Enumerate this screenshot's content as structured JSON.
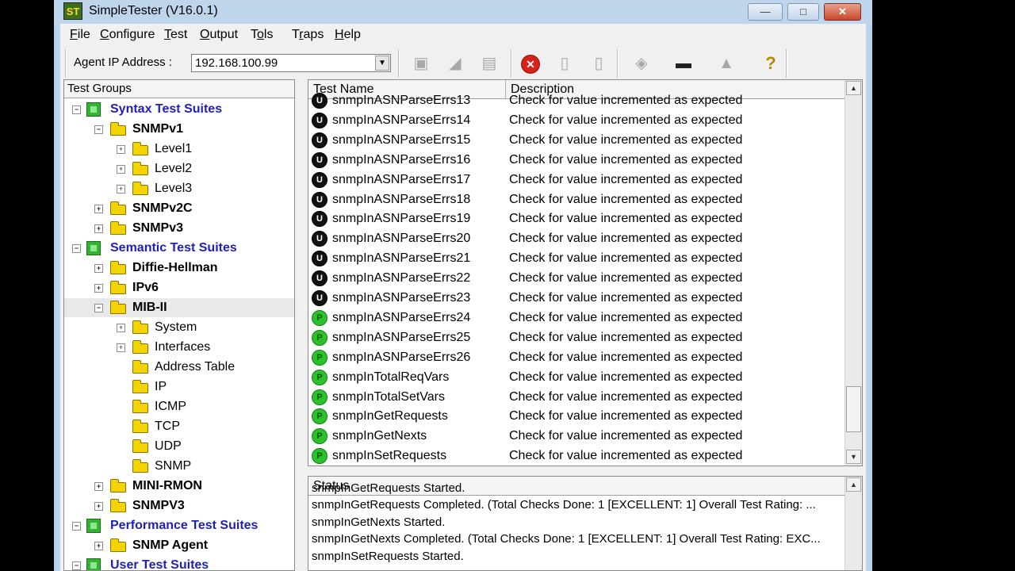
{
  "window": {
    "app_icon": "ST",
    "title": "SimpleTester (V16.0.1)",
    "controls": {
      "minimize": "—",
      "maximize": "□",
      "close": "✕"
    }
  },
  "menu": [
    {
      "label": "File",
      "accel": "F",
      "rest": "ile"
    },
    {
      "label": "Configure",
      "accel": "C",
      "rest": "onfigure"
    },
    {
      "label": "Test",
      "accel": "T",
      "rest": "est"
    },
    {
      "label": "Output",
      "accel": "O",
      "rest": "utput"
    },
    {
      "label": "Tools",
      "accel": "o",
      "pre": "T",
      "rest": "ls"
    },
    {
      "label": "Traps",
      "accel": "r",
      "pre": "T",
      "rest": "aps"
    },
    {
      "label": "Help",
      "accel": "H",
      "rest": "elp"
    }
  ],
  "toolbar": {
    "agent_ip_label": "Agent IP Address :",
    "agent_ip_value": "192.168.100.99",
    "icons": [
      "new-icon",
      "open-icon",
      "save-icon",
      "stop-icon",
      "report-icon",
      "export-icon",
      "notes-icon",
      "trap-icon",
      "alert-icon",
      "help-icon"
    ]
  },
  "tree": {
    "header": "Test Groups",
    "nodes": [
      {
        "label": "Syntax Test Suites",
        "level": 0,
        "kind": "suite",
        "exp": "-"
      },
      {
        "label": "SNMPv1",
        "level": 1,
        "kind": "folder",
        "exp": "-",
        "bold": true
      },
      {
        "label": "Level1",
        "level": 2,
        "kind": "folder",
        "exp": "+"
      },
      {
        "label": "Level2",
        "level": 2,
        "kind": "folder",
        "exp": "+"
      },
      {
        "label": "Level3",
        "level": 2,
        "kind": "folder",
        "exp": "+"
      },
      {
        "label": "SNMPv2C",
        "level": 1,
        "kind": "folder",
        "exp": "+",
        "bold": true
      },
      {
        "label": "SNMPv3",
        "level": 1,
        "kind": "folder",
        "exp": "+",
        "bold": true
      },
      {
        "label": "Semantic Test Suites",
        "level": 0,
        "kind": "suite",
        "exp": "-"
      },
      {
        "label": "Diffie-Hellman",
        "level": 1,
        "kind": "folder",
        "exp": "+",
        "bold": true
      },
      {
        "label": "IPv6",
        "level": 1,
        "kind": "folder",
        "exp": "+",
        "bold": true
      },
      {
        "label": "MIB-II",
        "level": 1,
        "kind": "folder",
        "exp": "-",
        "bold": true,
        "selected": true
      },
      {
        "label": "System",
        "level": 2,
        "kind": "folder",
        "exp": "+"
      },
      {
        "label": "Interfaces",
        "level": 2,
        "kind": "folder",
        "exp": "+"
      },
      {
        "label": "Address Table",
        "level": 2,
        "kind": "folder",
        "exp": ""
      },
      {
        "label": "IP",
        "level": 2,
        "kind": "folder",
        "exp": ""
      },
      {
        "label": "ICMP",
        "level": 2,
        "kind": "folder",
        "exp": ""
      },
      {
        "label": "TCP",
        "level": 2,
        "kind": "folder",
        "exp": ""
      },
      {
        "label": "UDP",
        "level": 2,
        "kind": "folder",
        "exp": ""
      },
      {
        "label": "SNMP",
        "level": 2,
        "kind": "folder",
        "exp": ""
      },
      {
        "label": "MINI-RMON",
        "level": 1,
        "kind": "folder",
        "exp": "+",
        "bold": true
      },
      {
        "label": "SNMPV3",
        "level": 1,
        "kind": "folder",
        "exp": "+",
        "bold": true
      },
      {
        "label": "Performance Test Suites",
        "level": 0,
        "kind": "suite",
        "exp": "-"
      },
      {
        "label": "SNMP Agent",
        "level": 1,
        "kind": "folder",
        "exp": "+",
        "bold": true
      },
      {
        "label": "User Test Suites",
        "level": 0,
        "kind": "suite",
        "exp": "-"
      }
    ]
  },
  "test_list": {
    "columns": [
      "Test Name",
      "Description"
    ],
    "rows": [
      {
        "name": "snmpInASNParseErrs13",
        "desc": "Check for value incremented as expected",
        "status": "u"
      },
      {
        "name": "snmpInASNParseErrs14",
        "desc": "Check for value incremented as expected",
        "status": "u"
      },
      {
        "name": "snmpInASNParseErrs15",
        "desc": "Check for value incremented as expected",
        "status": "u"
      },
      {
        "name": "snmpInASNParseErrs16",
        "desc": "Check for value incremented as expected",
        "status": "u"
      },
      {
        "name": "snmpInASNParseErrs17",
        "desc": "Check for value incremented as expected",
        "status": "u"
      },
      {
        "name": "snmpInASNParseErrs18",
        "desc": "Check for value incremented as expected",
        "status": "u"
      },
      {
        "name": "snmpInASNParseErrs19",
        "desc": "Check for value incremented as expected",
        "status": "u"
      },
      {
        "name": "snmpInASNParseErrs20",
        "desc": "Check for value incremented as expected",
        "status": "u"
      },
      {
        "name": "snmpInASNParseErrs21",
        "desc": "Check for value incremented as expected",
        "status": "u"
      },
      {
        "name": "snmpInASNParseErrs22",
        "desc": "Check for value incremented as expected",
        "status": "u"
      },
      {
        "name": "snmpInASNParseErrs23",
        "desc": "Check for value incremented as expected",
        "status": "u"
      },
      {
        "name": "snmpInASNParseErrs24",
        "desc": "Check for value incremented as expected",
        "status": "p"
      },
      {
        "name": "snmpInASNParseErrs25",
        "desc": "Check for value incremented as expected",
        "status": "p"
      },
      {
        "name": "snmpInASNParseErrs26",
        "desc": "Check for value incremented as expected",
        "status": "p"
      },
      {
        "name": "snmpInTotalReqVars",
        "desc": "Check for value incremented as expected",
        "status": "p"
      },
      {
        "name": "snmpInTotalSetVars",
        "desc": "Check for value incremented as expected",
        "status": "p"
      },
      {
        "name": "snmpInGetRequests",
        "desc": "Check for value incremented as expected",
        "status": "p"
      },
      {
        "name": "snmpInGetNexts",
        "desc": "Check for value incremented as expected",
        "status": "p"
      },
      {
        "name": "snmpInSetRequests",
        "desc": "Check for value incremented as expected",
        "status": "p"
      }
    ],
    "status_marks": {
      "u": "U",
      "p": "P"
    }
  },
  "status": {
    "header": "Status",
    "lines": [
      "snmpInGetRequests Started.",
      "snmpInGetRequests Completed. (Total Checks Done: 1 [EXCELLENT: 1] Overall Test Rating: ...",
      "snmpInGetNexts Started.",
      "snmpInGetNexts Completed. (Total Checks Done: 1 [EXCELLENT: 1] Overall Test Rating: EXC...",
      "snmpInSetRequests Started."
    ]
  },
  "colors": {
    "suite_text": "#1f1fbd",
    "pass": "#2ac12a",
    "untested": "#111111"
  }
}
